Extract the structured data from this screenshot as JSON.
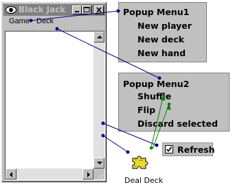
{
  "window": {
    "title": "Black Jack",
    "menu": [
      "Game",
      "Deck"
    ]
  },
  "popup_menu1": {
    "title": "Popup Menu1",
    "items": [
      "New player",
      "New deck",
      "New hand"
    ]
  },
  "popup_menu2": {
    "title": "Popup Menu2",
    "items": [
      "Shuffle",
      "Flip",
      "Discard selected"
    ]
  },
  "refresh": {
    "label": "Refresh",
    "checked": true
  },
  "deal_deck": {
    "label": "Deal Deck",
    "icon": "jigsaw-puzzle-icon"
  },
  "colors": {
    "panel": "#c0c0c0",
    "connector": "#000080",
    "arrow": "#008000",
    "deal_icon": "#e8d830"
  }
}
